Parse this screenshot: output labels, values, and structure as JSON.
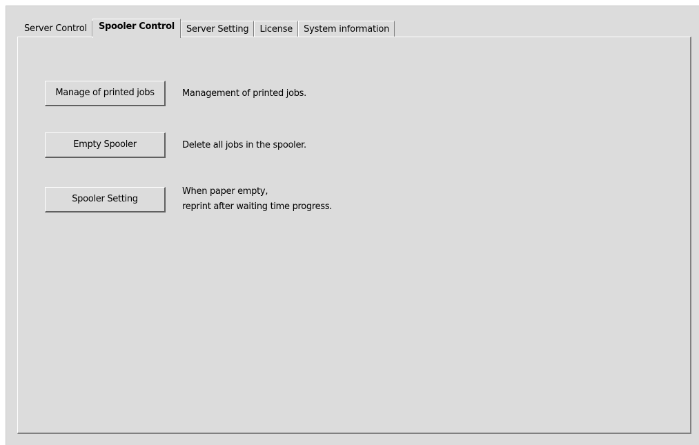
{
  "tabs": [
    {
      "label": "Server Control",
      "active": false
    },
    {
      "label": "Spooler Control",
      "active": true
    },
    {
      "label": "Server Setting",
      "active": false
    },
    {
      "label": "License",
      "active": false
    },
    {
      "label": "System information",
      "active": false
    }
  ],
  "spooler": {
    "manage_button": "Manage of printed jobs",
    "manage_desc": "Management of printed jobs.",
    "empty_button": "Empty Spooler",
    "empty_desc": "Delete all jobs in the spooler.",
    "setting_button": "Spooler Setting",
    "setting_desc_line1": "When paper empty,",
    "setting_desc_line2": "reprint after waiting time progress."
  }
}
